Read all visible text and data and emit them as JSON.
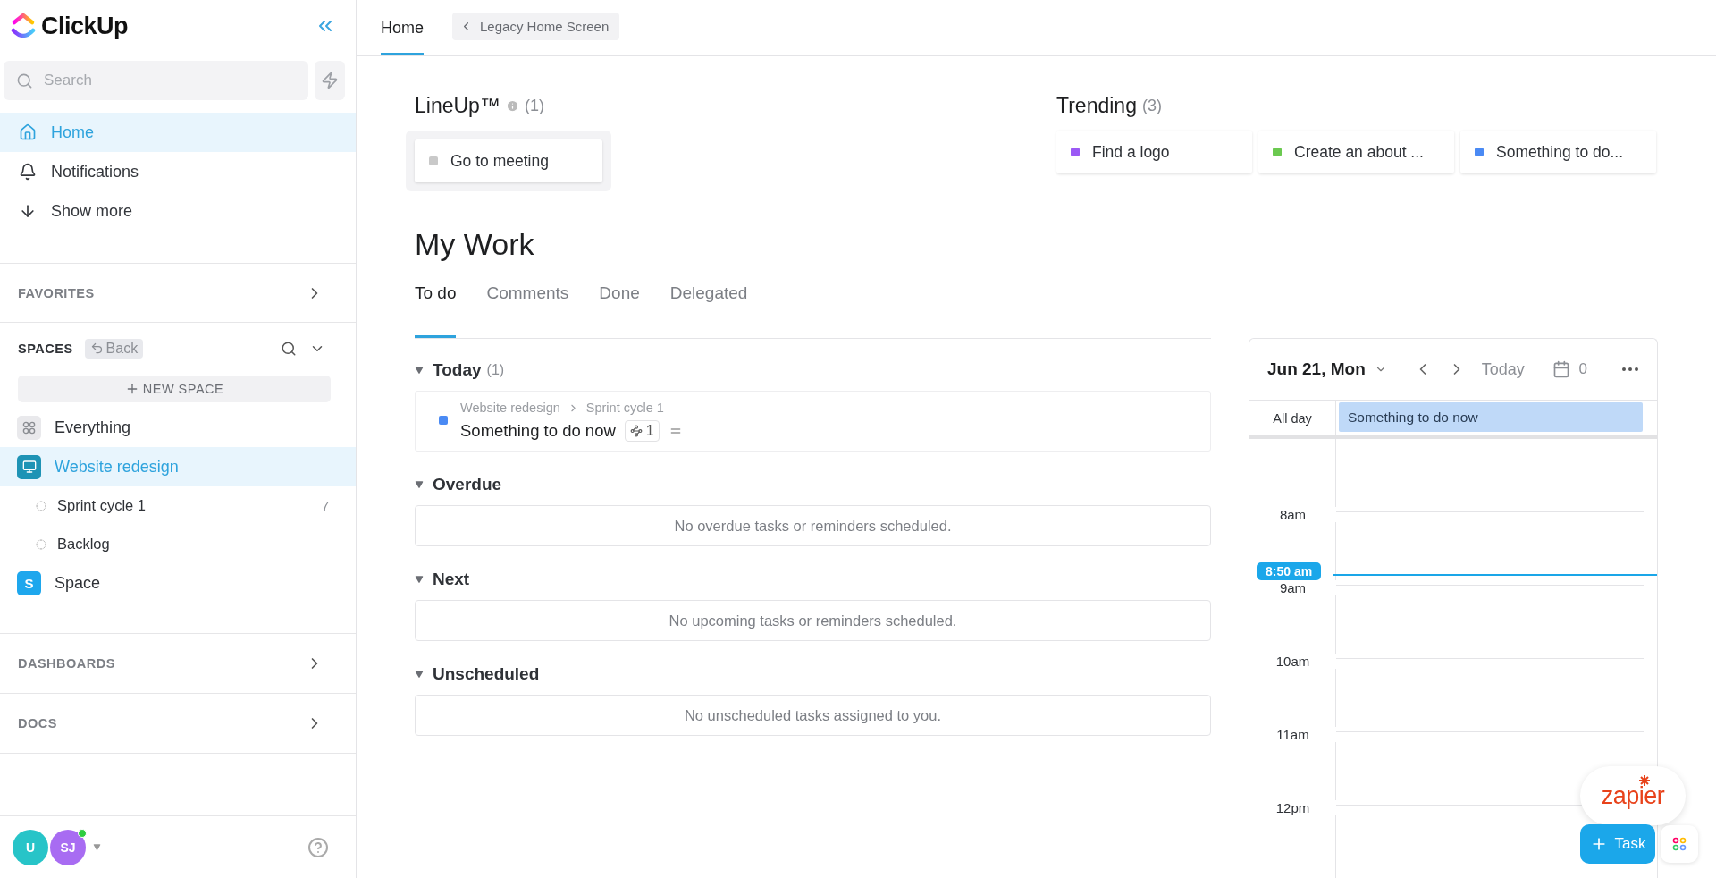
{
  "sidebar": {
    "logo": "ClickUp",
    "search": {
      "placeholder": "Search"
    },
    "nav": [
      {
        "label": "Home",
        "selected": true
      },
      {
        "label": "Notifications",
        "selected": false
      },
      {
        "label": "Show more",
        "selected": false
      }
    ],
    "favorites": {
      "title": "FAVORITES"
    },
    "spaces": {
      "title": "SPACES",
      "back": "Back",
      "new_space": "NEW SPACE",
      "items": [
        {
          "kind": "everything",
          "label": "Everything",
          "selected": false
        },
        {
          "kind": "project",
          "label": "Website redesign",
          "selected": true,
          "children": [
            {
              "label": "Sprint cycle 1",
              "count": "7"
            },
            {
              "label": "Backlog"
            }
          ]
        },
        {
          "kind": "letter",
          "badge": "S",
          "label": "Space",
          "selected": false
        }
      ]
    },
    "sections": [
      {
        "title": "DASHBOARDS"
      },
      {
        "title": "DOCS"
      }
    ],
    "avatars": [
      {
        "initials": "U",
        "color": "#27c4c8",
        "online": false
      },
      {
        "initials": "SJ",
        "color": "#a86cf2",
        "online": true
      }
    ]
  },
  "top_bar": {
    "tabs": [
      {
        "label": "Home",
        "selected": true
      }
    ],
    "legacy": "Legacy Home Screen"
  },
  "lineup": {
    "title": "LineUp™",
    "count": "(1)",
    "items": [
      {
        "label": "Go to meeting",
        "color": "#c9c9c9"
      }
    ]
  },
  "trending": {
    "title": "Trending",
    "count": "(3)",
    "items": [
      {
        "label": "Find a logo",
        "color": "#9b59f5"
      },
      {
        "label": "Create an about ...",
        "color": "#6bc950"
      },
      {
        "label": "Something to do...",
        "color": "#4a8af4"
      }
    ]
  },
  "my_work": {
    "title": "My Work",
    "tabs": [
      {
        "label": "To do",
        "selected": true
      },
      {
        "label": "Comments",
        "selected": false
      },
      {
        "label": "Done",
        "selected": false
      },
      {
        "label": "Delegated",
        "selected": false
      }
    ],
    "groups": [
      {
        "title": "Today",
        "count": "(1)",
        "expanded": true,
        "tasks": [
          {
            "path": [
              "Website redesign",
              "Sprint cycle 1"
            ],
            "name": "Something to do now",
            "color": "#4a8af4",
            "subtasks": "1"
          }
        ]
      },
      {
        "title": "Overdue",
        "expanded": true,
        "empty": "No overdue tasks or reminders scheduled."
      },
      {
        "title": "Next",
        "expanded": true,
        "empty": "No upcoming tasks or reminders scheduled."
      },
      {
        "title": "Unscheduled",
        "expanded": true,
        "empty": "No unscheduled tasks assigned to you."
      }
    ]
  },
  "calendar": {
    "date": "Jun 21, Mon",
    "today": "Today",
    "count": "0",
    "all_day": "All day",
    "events": [
      "Something to do now"
    ],
    "hours": [
      "8am",
      "9am",
      "10am",
      "11am",
      "12pm"
    ],
    "now": "8:50 am"
  },
  "zapier": "zapier",
  "task_button": "Task"
}
